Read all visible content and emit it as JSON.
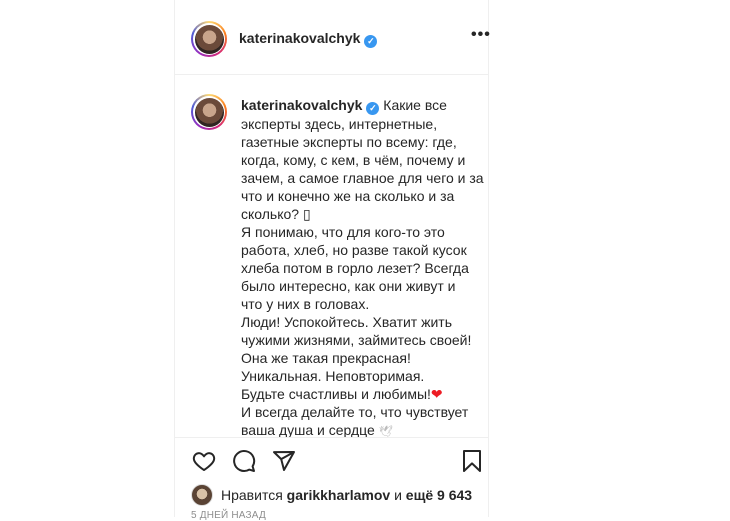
{
  "post": {
    "header": {
      "username": "katerinakovalchyk",
      "verified_icon": "verified-badge-icon",
      "more_label": "•••"
    },
    "caption": {
      "username": "katerinakovalchyk",
      "lines": [
        "Какие все",
        "эксперты здесь, интернетные,",
        "газетные эксперты по всему: где,",
        "когда, кому, с кем, в чём, почему и",
        "зачем, а самое главное для чего и за",
        "что и конечно же на сколько и за",
        "сколько? ▯",
        "Я понимаю, что для кого-то это",
        "работа, хлеб, но разве такой кусок",
        "хлеба потом в горло лезет? Всегда",
        "было интересно, как они живут и",
        "что у них в головах.",
        "Люди! Успокойтесь. Хватит жить",
        "чужими жизнями, займитесь своей!",
        "Она же такая прекрасная!",
        "Уникальная. Неповторимая.",
        "Будьте счастливы и любимы!",
        "И всегда делайте то, что чувствует",
        "ваша душа и сердце"
      ],
      "heart_emoji": "❤",
      "dove_emoji": "🕊"
    },
    "actions": {
      "like_icon": "heart-outline-icon",
      "comment_icon": "comment-icon",
      "share_icon": "paper-plane-icon",
      "save_icon": "bookmark-icon"
    },
    "likes": {
      "prefix": "Нравится",
      "liker": "garikkharlamov",
      "middle": "и",
      "others": "ещё 9 643"
    },
    "timestamp": "5 дней назад"
  }
}
